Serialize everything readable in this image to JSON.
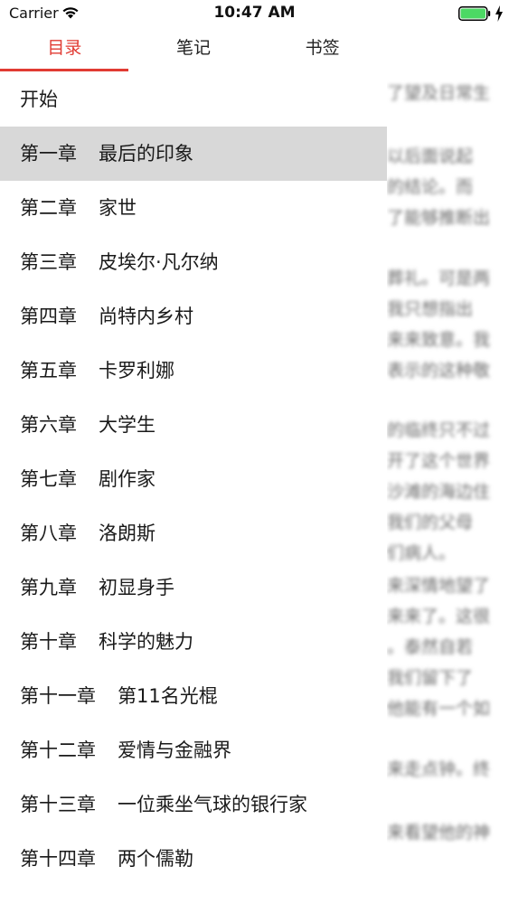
{
  "status_bar": {
    "carrier": "Carrier",
    "time": "10:47 AM",
    "battery_color": "#4cd964"
  },
  "tabs": [
    {
      "label": "目录",
      "active": true
    },
    {
      "label": "笔记",
      "active": false
    },
    {
      "label": "书签",
      "active": false
    }
  ],
  "accent_color": "#e13b33",
  "toc": {
    "start_label": "开始",
    "items": [
      {
        "num": "第一章",
        "title": "最后的印象",
        "selected": true
      },
      {
        "num": "第二章",
        "title": "家世"
      },
      {
        "num": "第三章",
        "title": "皮埃尔·凡尔纳"
      },
      {
        "num": "第四章",
        "title": "尚特内乡村"
      },
      {
        "num": "第五章",
        "title": "卡罗利娜"
      },
      {
        "num": "第六章",
        "title": "大学生"
      },
      {
        "num": "第七章",
        "title": "剧作家"
      },
      {
        "num": "第八章",
        "title": "洛朗斯"
      },
      {
        "num": "第九章",
        "title": "初显身手"
      },
      {
        "num": "第十章",
        "title": "科学的魅力"
      },
      {
        "num": "第十一章",
        "title": "第11名光棍"
      },
      {
        "num": "第十二章",
        "title": "爱情与金融界"
      },
      {
        "num": "第十三章",
        "title": "一位乘坐气球的银行家"
      },
      {
        "num": "第十四章",
        "title": "两个儒勒"
      }
    ]
  },
  "reader_background_lines": [
    "了望及日常生",
    "以后面说起",
    "的结论。而",
    "了能够推断出",
    "葬礼。可是两",
    "我只想指出",
    "来来致意。我",
    "表示的这种敬",
    "的临终只不过",
    "开了这个世界",
    "沙滩的海边住",
    "我们的父母",
    "们病人。",
    "来深情地望了",
    "来来了。这很",
    "。泰然自若",
    "我们留下了",
    "他能有一个如",
    "来走点钟。终",
    "来看望他的神"
  ]
}
